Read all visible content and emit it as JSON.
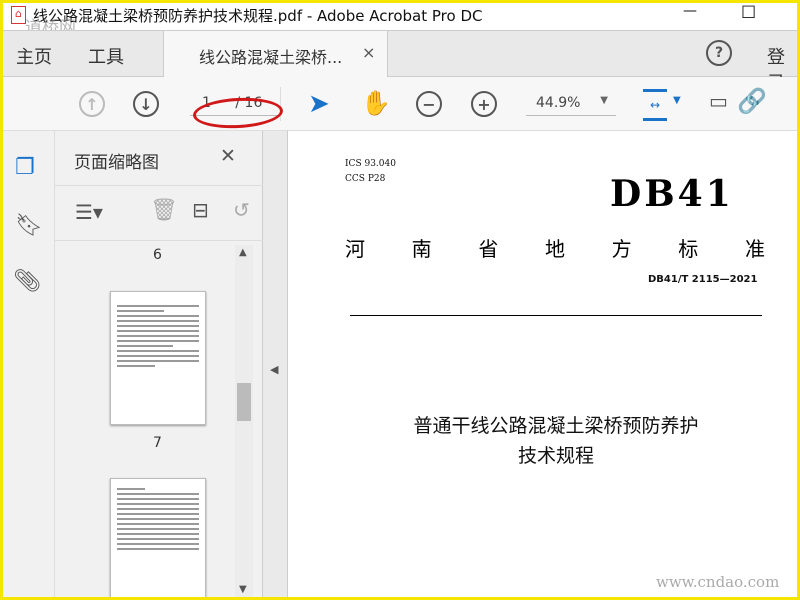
{
  "window": {
    "title": "线公路混凝土梁桥预防养护技术规程.pdf - Adobe Acrobat Pro DC",
    "watermark_top": "道桥网",
    "watermark_bottom": "www.cndao.com",
    "minimize": "—",
    "maximize": "☐"
  },
  "tabs": {
    "home": "主页",
    "tools": "工具",
    "doc": "线公路混凝土梁桥...",
    "close": "×",
    "help": "?",
    "login": "登录"
  },
  "toolbar": {
    "page_current": "1",
    "page_total": "/ 16",
    "zoom": "44.9%"
  },
  "panel": {
    "title": "页面缩略图",
    "close": "✕",
    "thumbs": [
      {
        "label": "6"
      },
      {
        "label": "7"
      }
    ]
  },
  "document": {
    "ics": "ICS",
    "ics_val": "93.040",
    "ccs": "CCS",
    "ccs_val": "P28",
    "db": "DB41",
    "province": "河南省地方标准",
    "chars": [
      "河",
      "南",
      "省",
      "地",
      "方",
      "标",
      "准"
    ],
    "code": "DB41/T 2115—2021",
    "title1": "普通干线公路混凝土梁桥预防养护",
    "title2": "技术规程"
  },
  "colors": {
    "accent": "#1a73c9",
    "annotation": "#d01818",
    "border": "#f5e600"
  }
}
